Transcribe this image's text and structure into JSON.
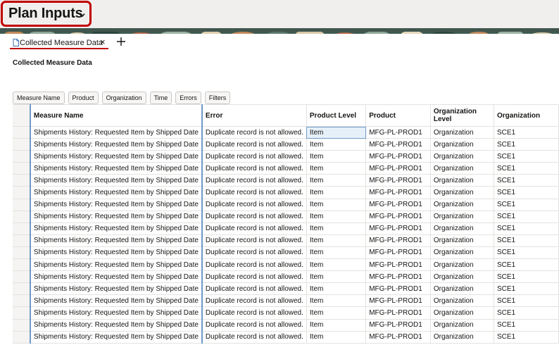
{
  "header": {
    "title": "Plan Inputs"
  },
  "tabs": [
    {
      "label": "Collected Measure Data",
      "close": "×"
    }
  ],
  "section_title": "Collected Measure Data",
  "facets": [
    "Measure Name",
    "Product",
    "Organization",
    "Time",
    "Errors",
    "Filters"
  ],
  "table": {
    "columns": [
      "Measure Name",
      "Error",
      "Product Level",
      "Product",
      "Organization Level",
      "Organization"
    ],
    "rows": [
      [
        "Shipments History: Requested Item by Shipped Date",
        "Duplicate record is not allowed.",
        "Item",
        "MFG-PL-PROD1",
        "Organization",
        "SCE1"
      ],
      [
        "Shipments History: Requested Item by Shipped Date",
        "Duplicate record is not allowed.",
        "Item",
        "MFG-PL-PROD1",
        "Organization",
        "SCE1"
      ],
      [
        "Shipments History: Requested Item by Shipped Date",
        "Duplicate record is not allowed.",
        "Item",
        "MFG-PL-PROD1",
        "Organization",
        "SCE1"
      ],
      [
        "Shipments History: Requested Item by Shipped Date",
        "Duplicate record is not allowed.",
        "Item",
        "MFG-PL-PROD1",
        "Organization",
        "SCE1"
      ],
      [
        "Shipments History: Requested Item by Shipped Date",
        "Duplicate record is not allowed.",
        "Item",
        "MFG-PL-PROD1",
        "Organization",
        "SCE1"
      ],
      [
        "Shipments History: Requested Item by Shipped Date",
        "Duplicate record is not allowed.",
        "Item",
        "MFG-PL-PROD1",
        "Organization",
        "SCE1"
      ],
      [
        "Shipments History: Requested Item by Shipped Date",
        "Duplicate record is not allowed.",
        "Item",
        "MFG-PL-PROD1",
        "Organization",
        "SCE1"
      ],
      [
        "Shipments History: Requested Item by Shipped Date",
        "Duplicate record is not allowed.",
        "Item",
        "MFG-PL-PROD1",
        "Organization",
        "SCE1"
      ],
      [
        "Shipments History: Requested Item by Shipped Date",
        "Duplicate record is not allowed.",
        "Item",
        "MFG-PL-PROD1",
        "Organization",
        "SCE1"
      ],
      [
        "Shipments History: Requested Item by Shipped Date",
        "Duplicate record is not allowed.",
        "Item",
        "MFG-PL-PROD1",
        "Organization",
        "SCE1"
      ],
      [
        "Shipments History: Requested Item by Shipped Date",
        "Duplicate record is not allowed.",
        "Item",
        "MFG-PL-PROD1",
        "Organization",
        "SCE1"
      ],
      [
        "Shipments History: Requested Item by Shipped Date",
        "Duplicate record is not allowed.",
        "Item",
        "MFG-PL-PROD1",
        "Organization",
        "SCE1"
      ],
      [
        "Shipments History: Requested Item by Shipped Date",
        "Duplicate record is not allowed.",
        "Item",
        "MFG-PL-PROD1",
        "Organization",
        "SCE1"
      ],
      [
        "Shipments History: Requested Item by Shipped Date",
        "Duplicate record is not allowed.",
        "Item",
        "MFG-PL-PROD1",
        "Organization",
        "SCE1"
      ],
      [
        "Shipments History: Requested Item by Shipped Date",
        "Duplicate record is not allowed.",
        "Item",
        "MFG-PL-PROD1",
        "Organization",
        "SCE1"
      ],
      [
        "Shipments History: Requested Item by Shipped Date",
        "Duplicate record is not allowed.",
        "Item",
        "MFG-PL-PROD1",
        "Organization",
        "SCE1"
      ],
      [
        "Shipments History: Requested Item by Shipped Date",
        "Duplicate record is not allowed.",
        "Item",
        "MFG-PL-PROD1",
        "Organization",
        "SCE1"
      ],
      [
        "Shipments History: Requested Item by Shipped Date",
        "Duplicate record is not allowed.",
        "Item",
        "MFG-PL-PROD1",
        "Organization",
        "SCE1"
      ]
    ]
  },
  "colors": {
    "highlight_border": "#c00000",
    "accent": "#6f9ac9",
    "selected_cell": "#e6f0f9"
  },
  "icons": {
    "title_menu": "chevron-down-icon",
    "tab": "document-icon",
    "add_tab": "plus-icon"
  }
}
